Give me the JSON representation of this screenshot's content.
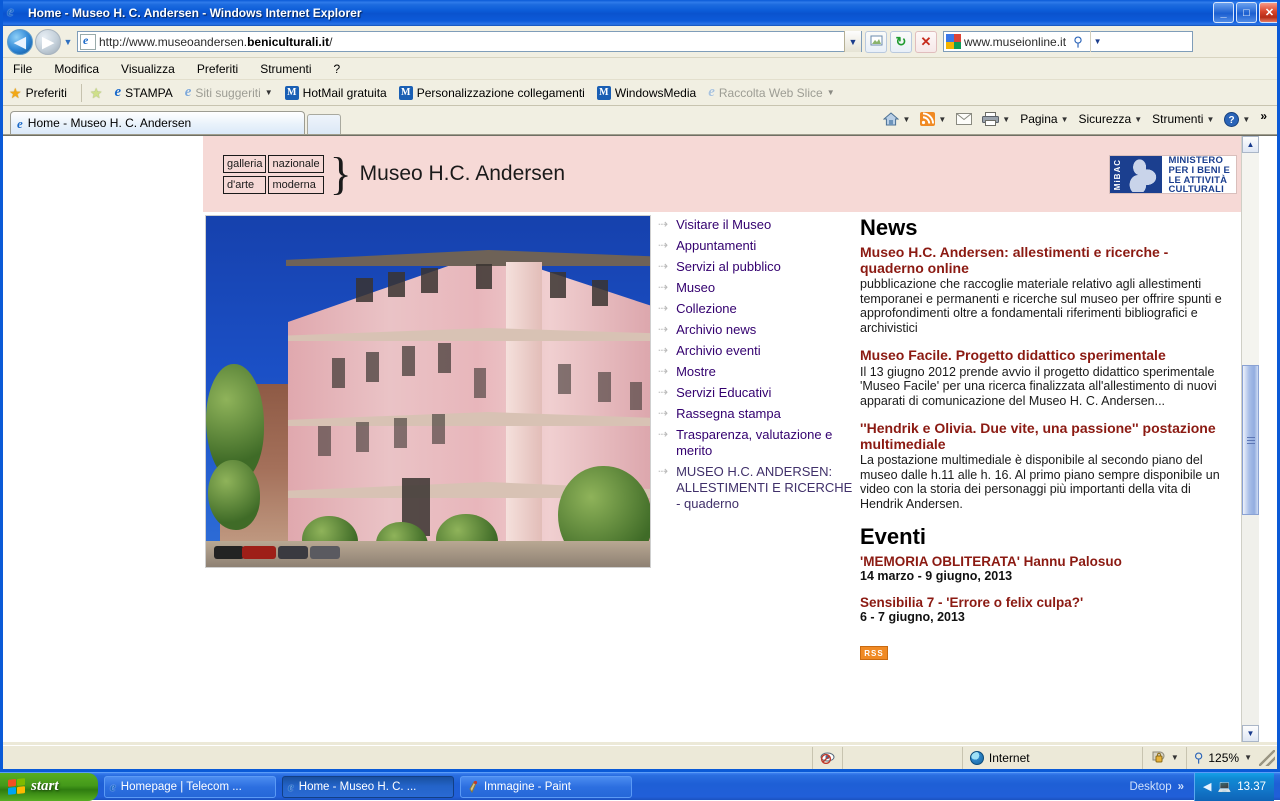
{
  "window": {
    "title": "Home - Museo H. C. Andersen - Windows Internet Explorer",
    "minimize_label": "_",
    "maximize_label": "□",
    "close_label": "✕"
  },
  "address_bar": {
    "url_prefix": "http://www.museoandersen.",
    "url_domain": "beniculturali.it",
    "url_suffix": "/",
    "url_full": "http://www.museoandersen.beniculturali.it/",
    "back_icon": "◀",
    "forward_icon": "▶",
    "history_caret": "▼",
    "dropdown_caret": "▼",
    "compat_view_icon": "compatibility-view-icon",
    "refresh_icon": "↻",
    "stop_icon": "✕",
    "search_value": "www.museionline.it",
    "search_go_icon": "⚲",
    "search_caret": "▼"
  },
  "menu": {
    "items": [
      "File",
      "Modifica",
      "Visualizza",
      "Preferiti",
      "Strumenti",
      "?"
    ]
  },
  "favorites_bar": {
    "favorites_label": "Preferiti",
    "items": [
      {
        "label": "STAMPA",
        "icon": "ie-icon",
        "dim": false,
        "caret": false
      },
      {
        "label": "Siti suggeriti",
        "icon": "ie-icon",
        "dim": true,
        "caret": true
      },
      {
        "label": "HotMail gratuita",
        "icon": "msn-icon",
        "dim": false,
        "caret": false
      },
      {
        "label": "Personalizzazione collegamenti",
        "icon": "msn-icon",
        "dim": false,
        "caret": false
      },
      {
        "label": "WindowsMedia",
        "icon": "msn-icon",
        "dim": false,
        "caret": false
      },
      {
        "label": "Raccolta Web Slice",
        "icon": "ie-icon",
        "dim": true,
        "caret": true
      }
    ]
  },
  "tabs": {
    "active_tab_label": "Home - Museo H. C. Andersen",
    "new_tab_label": "",
    "tools": [
      {
        "label": "",
        "icon": "home-icon",
        "caret": true
      },
      {
        "label": "",
        "icon": "feeds-icon",
        "caret": true
      },
      {
        "label": "",
        "icon": "mail-icon",
        "caret": false
      },
      {
        "label": "",
        "icon": "print-icon",
        "caret": true
      },
      {
        "label": "Pagina",
        "icon": "",
        "caret": true
      },
      {
        "label": "Sicurezza",
        "icon": "",
        "caret": true
      },
      {
        "label": "Strumenti",
        "icon": "",
        "caret": true
      },
      {
        "label": "",
        "icon": "help-icon",
        "caret": true
      }
    ],
    "overflow_label": "»"
  },
  "site": {
    "logo": {
      "box_1": "galleria",
      "box_2": "nazionale",
      "box_3": "d'arte",
      "box_4": "moderna",
      "brace": "}",
      "museum_name": "Museo H.C. Andersen"
    },
    "ministry": {
      "acronym": "MiBAC",
      "line_1": "MINISTERO",
      "line_2": "PER I BENI E",
      "line_3": "LE ATTIVITÀ",
      "line_4": "CULTURALI"
    },
    "photo_alt": "Museo H.C. Andersen building exterior",
    "nav": {
      "arrow_glyph": "⇢",
      "items": [
        "Visitare il Museo",
        "Appuntamenti",
        "Servizi al pubblico",
        "Museo",
        "Collezione",
        "Archivio news",
        "Archivio eventi",
        "Mostre",
        "Servizi Educativi",
        "Rassegna stampa",
        "Trasparenza, valutazione e merito",
        "MUSEO H.C. ANDERSEN: ALLESTIMENTI E RICERCHE - quaderno"
      ]
    },
    "news": {
      "heading": "News",
      "items": [
        {
          "title": "Museo H.C. Andersen: allestimenti e ricerche - quaderno online",
          "body": "pubblicazione che raccoglie materiale relativo agli allestimenti temporanei e permanenti e ricerche sul museo per offrire spunti e approfondimenti oltre a fondamentali riferimenti bibliografici e archivistici"
        },
        {
          "title": "Museo Facile. Progetto didattico sperimentale",
          "body": "Il 13 giugno 2012 prende avvio il progetto didattico sperimentale 'Museo Facile' per una ricerca finalizzata all'allestimento di nuovi apparati di comunicazione del Museo H. C. Andersen..."
        },
        {
          "title": "''Hendrik e Olivia. Due vite, una passione'' postazione multimediale",
          "body": "La postazione multimediale è disponibile al secondo piano del museo dalle h.11 alle h. 16. Al primo piano sempre disponibile un video con la storia dei personaggi più importanti della vita di Hendrik Andersen."
        }
      ]
    },
    "events": {
      "heading": "Eventi",
      "items": [
        {
          "title": "'MEMORIA OBLITERATA' Hannu Palosuo",
          "date": "14 marzo - 9 giugno, 2013"
        },
        {
          "title": "Sensibilia 7 - 'Errore o felix culpa?'",
          "date": "6 - 7 giugno, 2013"
        }
      ]
    },
    "rss_label": "RSS"
  },
  "scrollbar": {
    "up_arrow": "▲",
    "down_arrow": "▼"
  },
  "status_bar": {
    "zone_label": "Internet",
    "zoom_label": "125%",
    "zoom_icon": "⚲",
    "zoom_caret": "▼",
    "protected_caret": "▼",
    "blocked_icon": "popup-blocked-icon",
    "privacy_icon": "privacy-report-icon"
  },
  "taskbar": {
    "start_label": "start",
    "tasks": [
      {
        "label": "Homepage | Telecom ...",
        "icon": "ie-icon",
        "active": false
      },
      {
        "label": "Home - Museo H. C. ...",
        "icon": "ie-icon",
        "active": true
      },
      {
        "label": "Immagine - Paint",
        "icon": "paint-icon",
        "active": false
      }
    ],
    "desktop_label": "Desktop",
    "overflow_label": "»",
    "clock": "13.37",
    "tray_icons": [
      "show-hidden-icons",
      "network-icon"
    ]
  },
  "colors": {
    "titlebar_blue": "#0a5ad7",
    "site_pink": "#f6d9d6",
    "news_red": "#8b1a12",
    "nav_purple": "#33006f",
    "rss_orange": "#f08a24",
    "taskbar_blue": "#215fd8",
    "start_green": "#44991a"
  }
}
